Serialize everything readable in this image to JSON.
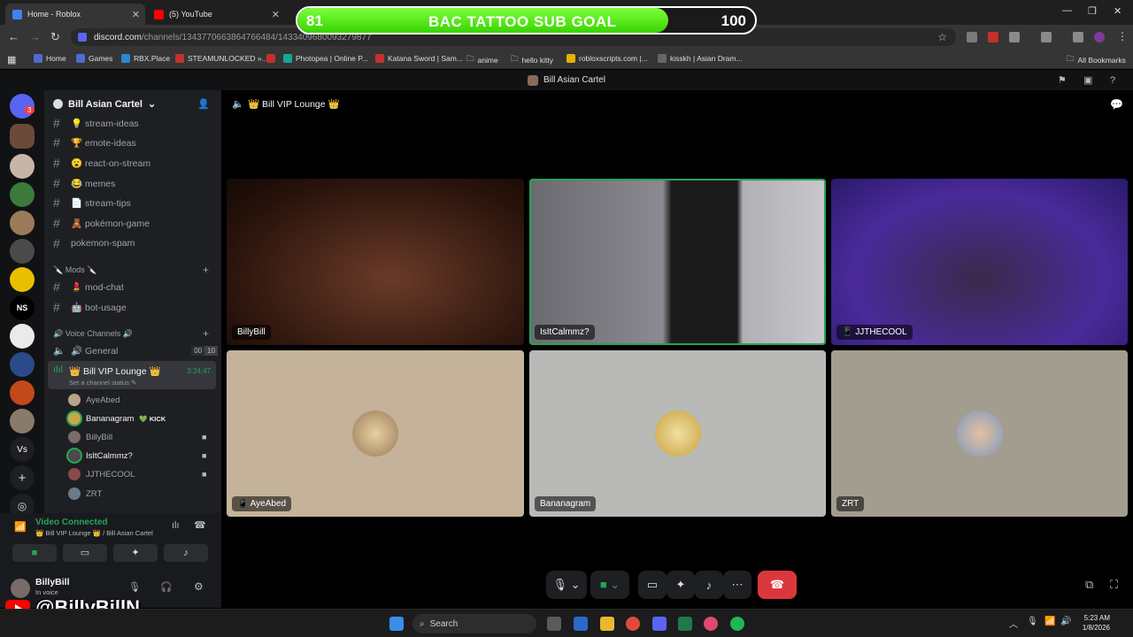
{
  "browser": {
    "tabs": [
      {
        "label": "Home - Roblox",
        "color": "#3b82f6"
      },
      {
        "label": "(5) YouTube",
        "color": "#ff0000"
      }
    ],
    "url": "discord.com",
    "url_path": "/channels/1343770663864766484/1433409680093279877",
    "bookmarks": [
      {
        "label": "Home",
        "color": "#4f6bd1"
      },
      {
        "label": "Games",
        "color": "#4f6bd1"
      },
      {
        "label": "RBX.Place",
        "color": "#2b88d8"
      },
      {
        "label": "STEAMUNLOCKED »...",
        "color": "#c4302b"
      },
      {
        "label": "Photopea | Online P...",
        "color": "#18a497"
      },
      {
        "label": "Katana Sword | Sam...",
        "color": "#c4302b"
      },
      {
        "label": "anime",
        "color": "#bbbbbb"
      },
      {
        "label": "hello kitty",
        "color": "#bbbbbb"
      },
      {
        "label": "robloxscripts.com |...",
        "color": "#e8b000"
      },
      {
        "label": "kisskh | Asian Dram...",
        "color": "#666666"
      }
    ],
    "all_bookmarks": "All Bookmarks"
  },
  "overlay_goal": {
    "current": "81",
    "title": "BAC TATTOO SUB GOAL",
    "max": "100",
    "progress": 0.81
  },
  "discord": {
    "window_title": "Bill Asian Cartel",
    "server_name": "Bill Asian Cartel",
    "channels": [
      {
        "label": "💡 stream-ideas"
      },
      {
        "label": "🏆 emote-ideas"
      },
      {
        "label": "😮 react-on-stream"
      },
      {
        "label": "😂 memes"
      },
      {
        "label": "📄 stream-tips"
      },
      {
        "label": "🧸 pokémon-game"
      },
      {
        "label": "pokemon-spam"
      }
    ],
    "mods_category": "🔪 Mods 🔪",
    "mod_channels": [
      {
        "label": "💄 mod-chat"
      },
      {
        "label": "🤖 bot-usage"
      }
    ],
    "voice_category": "🔊 Voice Channels 🔊",
    "voice_general": {
      "label": "🔊 General",
      "count_a": "00",
      "count_b": "10"
    },
    "voice_active": {
      "label": "👑 Bill VIP Lounge 👑",
      "timer": "3:24:47",
      "status": "Set a channel status ✎"
    },
    "voice_users": [
      {
        "name": "AyeAbed",
        "tag": ""
      },
      {
        "name": "Bananagram",
        "tag": "💚 KICK"
      },
      {
        "name": "BillyBill",
        "tag": ""
      },
      {
        "name": "IsItCalmmz?",
        "tag": ""
      },
      {
        "name": "JJTHECOOL",
        "tag": ""
      },
      {
        "name": "ZRT",
        "tag": ""
      }
    ],
    "connection": {
      "status": "Video Connected",
      "location": "👑 Bill VIP Lounge 👑 / Bill Asian Cartel"
    },
    "user": {
      "name": "BillyBill",
      "status": "In voice"
    },
    "stage_channel": "👑 Bill VIP Lounge 👑",
    "tiles": [
      {
        "name": "BillyBill"
      },
      {
        "name": "IsItCalmmz?"
      },
      {
        "name": "📱 JJTHECOOL"
      },
      {
        "name": "📱 AyeAbed"
      },
      {
        "name": "Bananagram"
      },
      {
        "name": "ZRT"
      }
    ],
    "unread_badge": "3"
  },
  "overlay_handle": "@BillyBillN",
  "taskbar": {
    "search": "Search",
    "time": "5:23 AM",
    "date": "1/8/2026"
  }
}
